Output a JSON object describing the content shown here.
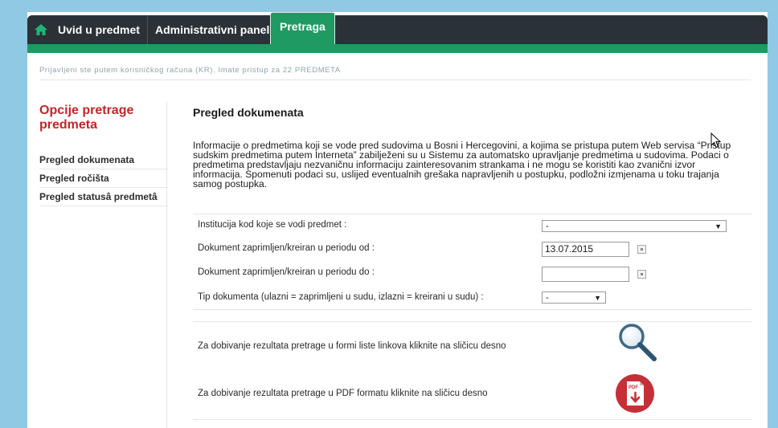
{
  "nav": {
    "home_icon": "home-icon",
    "items": [
      {
        "label": "Uvid u predmet"
      },
      {
        "label": "Administrativni panel"
      },
      {
        "label": "Pretraga"
      }
    ],
    "colors": {
      "dark": "#2a3237",
      "accent": "#1f9a63"
    }
  },
  "login_info": "Prijavljeni ste putem korisničkog računa (KR). Imate pristup za 22 PREDMETA",
  "sidebar": {
    "title": "Opcije pretrage predmeta",
    "items": [
      {
        "label": "Pregled dokumenata"
      },
      {
        "label": "Pregled ročišta"
      },
      {
        "label": "Pregled statusâ predmetâ"
      }
    ]
  },
  "main": {
    "title": "Pregled dokumenata",
    "intro": "Informacije o predmetima koji se vode pred sudovima u Bosni i Hercegovini, a kojima se pristupa putem Web servisa “Pristup sudskim predmetima putem Interneta” zabilježeni su u Sistemu za automatsko upravljanje predmetima u sudovima. Podaci o predmetima predstavljaju nezvaničnu informaciju zainteresovanim strankama i ne mogu se koristiti kao zvanični izvor informacija. Spomenuti podaci su, uslijed eventualnih grešaka napravljenih u postupku, podložni izmjenama u toku trajanja samog postupka.",
    "form": {
      "institution_label": "Institucija kod koje se vodi predmet :",
      "institution_value": "-",
      "date_from_label": "Dokument zaprimljen/kreiran u periodu od :",
      "date_from_value": "13.07.2015",
      "date_to_label": "Dokument zaprimljen/kreiran u periodu do :",
      "date_to_value": "",
      "doc_type_label": "Tip dokumenta (ulazni = zaprimljeni u sudu, izlazni = kreirani u sudu) :",
      "doc_type_value": "-"
    },
    "results": {
      "links_label": "Za dobivanje rezultata pretrage u formi liste linkova kliknite na sličicu desno",
      "links_icon": "magnifier-icon",
      "pdf_label": "Za dobivanje rezultata pretrage u PDF formatu kliknite na sličicu desno",
      "pdf_icon": "pdf-icon",
      "pdf_badge": "PDF"
    }
  }
}
